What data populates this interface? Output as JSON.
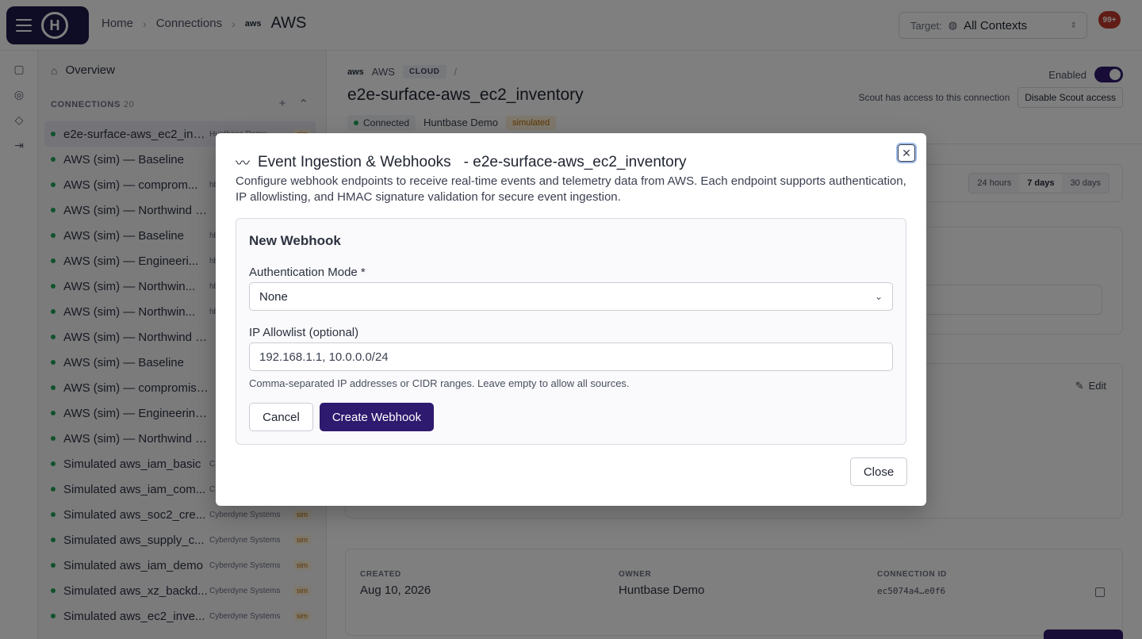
{
  "topbar": {
    "breadcrumbs": [
      "Home",
      "Connections"
    ],
    "current_provider_logo": "aws",
    "current": "AWS",
    "target_label": "Target:",
    "target_value": "All Contexts",
    "notification_count": "99+"
  },
  "sidebar": {
    "overview": "Overview",
    "connections_label": "CONNECTIONS",
    "connections_count": "20",
    "items": [
      {
        "name": "e2e-surface-aws_ec2_inve...",
        "owner": "Huntbase Demo",
        "sim": "sim",
        "active": true
      },
      {
        "name": "AWS (sim) — Baseline",
        "owner": "",
        "sim": ""
      },
      {
        "name": "AWS (sim) — comprom...",
        "owner": "hbde",
        "sim": ""
      },
      {
        "name": "AWS (sim) — Northwind Lo...",
        "owner": "",
        "sim": ""
      },
      {
        "name": "AWS (sim) — Baseline",
        "owner": "hbde",
        "sim": ""
      },
      {
        "name": "AWS (sim) — Engineeri...",
        "owner": "hbde",
        "sim": ""
      },
      {
        "name": "AWS (sim) — Northwin...",
        "owner": "hbde",
        "sim": ""
      },
      {
        "name": "AWS (sim) — Northwin...",
        "owner": "hbde",
        "sim": ""
      },
      {
        "name": "AWS (sim) — Northwind L...",
        "owner": "",
        "sim": ""
      },
      {
        "name": "AWS (sim) — Baseline",
        "owner": "",
        "sim": ""
      },
      {
        "name": "AWS (sim) — compromise...",
        "owner": "",
        "sim": ""
      },
      {
        "name": "AWS (sim) — Engineering ...",
        "owner": "",
        "sim": ""
      },
      {
        "name": "AWS (sim) — Northwind L...",
        "owner": "",
        "sim": ""
      },
      {
        "name": "Simulated aws_iam_basic",
        "owner": "C",
        "sim": ""
      },
      {
        "name": "Simulated aws_iam_com...",
        "owner": "C",
        "sim": ""
      },
      {
        "name": "Simulated aws_soc2_cre...",
        "owner": "Cyberdyne Systems",
        "sim": "sim"
      },
      {
        "name": "Simulated aws_supply_c...",
        "owner": "Cyberdyne Systems",
        "sim": "sim"
      },
      {
        "name": "Simulated aws_iam_demo",
        "owner": "Cyberdyne Systems",
        "sim": "sim"
      },
      {
        "name": "Simulated aws_xz_backd...",
        "owner": "Cyberdyne Systems",
        "sim": "sim"
      },
      {
        "name": "Simulated aws_ec2_inve...",
        "owner": "Cyberdyne Systems",
        "sim": "sim"
      }
    ]
  },
  "main": {
    "provider": "AWS",
    "cloud_tag": "CLOUD",
    "crumb_sep": "/",
    "title": "e2e-surface-aws_ec2_inventory",
    "status": "Connected",
    "owner": "Huntbase Demo",
    "sim_tag": "simulated",
    "enabled_label": "Enabled",
    "scout_text": "Scout has access to this connection",
    "scout_button": "Disable Scout access",
    "ranges": [
      "24 hours",
      "7 days",
      "30 days"
    ],
    "selected_range": "7 days",
    "edit_label": "Edit",
    "meta": {
      "created_label": "CREATED",
      "created_value": "Aug 10, 2026",
      "owner_label": "OWNER",
      "owner_value": "Huntbase Demo",
      "id_label": "CONNECTION ID",
      "id_value": "ec5074a4…e0f6"
    }
  },
  "modal": {
    "title": "Event Ingestion & Webhooks",
    "subtitle": "- e2e-surface-aws_ec2_inventory",
    "description": "Configure webhook endpoints to receive real-time events and telemetry data from AWS. Each endpoint supports authentication, IP allowlisting, and HMAC signature validation for secure event ingestion.",
    "form_title": "New Webhook",
    "auth_label": "Authentication Mode *",
    "auth_value": "None",
    "ip_label": "IP Allowlist (optional)",
    "ip_placeholder": "192.168.1.1, 10.0.0.0/24",
    "ip_help": "Comma-separated IP addresses or CIDR ranges. Leave empty to allow all sources.",
    "cancel": "Cancel",
    "create": "Create Webhook",
    "close": "Close"
  },
  "colors": {
    "brand": "#2e1a6e",
    "logo_bg": "#1e1b4b",
    "status_green": "#22a55a",
    "sim_orange": "#b86a00",
    "badge_red": "#c0392b"
  }
}
